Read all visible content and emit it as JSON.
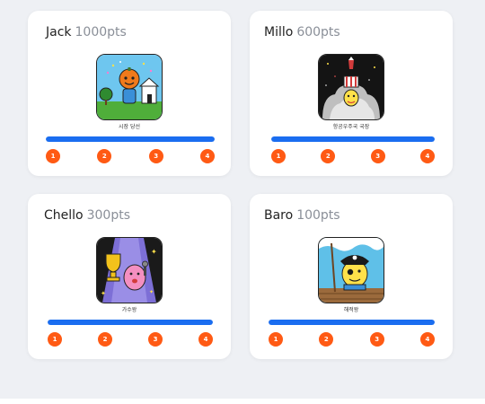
{
  "colors": {
    "progress": "#1a6df0",
    "step": "#ff5a14",
    "points_text": "#8a8f98"
  },
  "cards": [
    {
      "name": "Jack",
      "points": "1000pts",
      "badge_caption": "시장 당선",
      "badge_icon": "pumpkin-mayor-icon",
      "progress": 1.0,
      "steps": [
        "1",
        "2",
        "3",
        "4"
      ]
    },
    {
      "name": "Millo",
      "points": "600pts",
      "badge_caption": "항공우주국 국장",
      "badge_icon": "rocket-launch-icon",
      "progress": 1.0,
      "steps": [
        "1",
        "2",
        "3",
        "4"
      ]
    },
    {
      "name": "Chello",
      "points": "300pts",
      "badge_caption": "가수왕",
      "badge_icon": "trophy-singer-icon",
      "progress": 1.0,
      "steps": [
        "1",
        "2",
        "3",
        "4"
      ]
    },
    {
      "name": "Baro",
      "points": "100pts",
      "badge_caption": "해적왕",
      "badge_icon": "pirate-king-icon",
      "progress": 1.0,
      "steps": [
        "1",
        "2",
        "3",
        "4"
      ]
    }
  ]
}
